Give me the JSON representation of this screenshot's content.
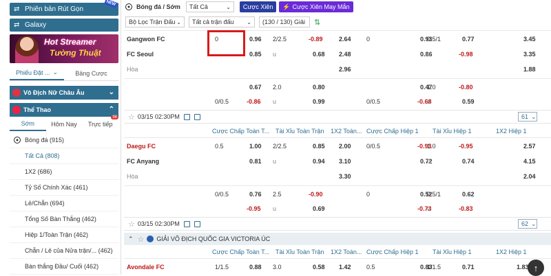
{
  "sidebar": {
    "rut_gon": "Phiên bản Rút Gọn",
    "new_badge": "NEW",
    "galaxy": "Galaxy",
    "banner_line1": "Hot Streamer",
    "banner_line2": "Tường Thuật",
    "tab_slip": "Phiếu Đặt ...",
    "tab_odds": "Bảng Cược",
    "womens_euro": "Vô Địch Nữ Châu Âu",
    "sports": "Thể Thao",
    "sport_tabs": [
      "Sớm",
      "Hôm Nay",
      "Trực tiếp"
    ],
    "live_count": "98",
    "menu_head": "Bóng đá (915)",
    "menu_items": [
      "Tất Cả (808)",
      "1X2 (686)",
      "Tỷ Số Chính Xác (461)",
      "Lẻ/Chẵn (694)",
      "Tổng Số Bàn Thắng (462)",
      "Hiệp 1/Toàn Trận (462)",
      "Chẵn / Lẻ của Nửa trận/... (462)",
      "Bàn thắng Đầu/ Cuối (462)"
    ]
  },
  "toolbar": {
    "title": "Bóng đá / Sớm",
    "filter_all": "Tất Cả",
    "parlay": "Cược Xiên",
    "lucky_parlay": "Cược Xiên May Mắn",
    "match_filter": "Bộ Lọc Trận Đấu",
    "all_matches": "Tất cả trận đấu",
    "league_count": "(130 / 130) Giải"
  },
  "match1": {
    "home": "Gangwon FC",
    "away": "FC Seoul",
    "draw": "Hòa",
    "r1": [
      "0",
      "0.96",
      "2/2.5",
      "-0.89",
      "2.64",
      "0",
      "0.93",
      "0.5/1",
      "0.77",
      "3.45"
    ],
    "r2": [
      "0.85",
      "u",
      "0.68",
      "2.48",
      "0.86",
      "u",
      "-0.98",
      "3.35"
    ],
    "r3": [
      "2.96",
      "1.88"
    ],
    "r4": [
      "0.67",
      "2.0",
      "0.80",
      "0.47",
      "1.0",
      "-0.80"
    ],
    "r5": [
      "0/0.5",
      "-0.86",
      "u",
      "0.99",
      "0/0.5",
      "-0.68",
      "u",
      "0.59"
    ]
  },
  "match2": {
    "time": "03/15 02:30PM",
    "more": "61",
    "headers": [
      "Cược Chấp Toàn T...",
      "Tài Xỉu Toàn Trận",
      "1X2 Toàn...",
      "Cược Chấp Hiệp 1",
      "Tài Xỉu Hiệp 1",
      "1X2 Hiệp 1"
    ],
    "home": "Daegu FC",
    "away": "FC Anyang",
    "draw": "Hòa",
    "r1": [
      "0.5",
      "1.00",
      "2/2.5",
      "0.85",
      "2.00",
      "0/0.5",
      "-0.93",
      "1.0",
      "-0.95",
      "2.57"
    ],
    "r2": [
      "0.81",
      "u",
      "0.94",
      "3.10",
      "0.72",
      "u",
      "0.74",
      "4.15"
    ],
    "r3": [
      "3.30",
      "2.04"
    ],
    "r4": [
      "0/0.5",
      "0.76",
      "2.5",
      "-0.90",
      "0",
      "0.52",
      "0.5/1",
      "0.62"
    ],
    "r5": [
      "-0.95",
      "u",
      "0.69",
      "-0.73",
      "u",
      "-0.83"
    ]
  },
  "match3": {
    "time": "03/15 02:30PM",
    "more": "62",
    "league": "GIẢI VÔ ĐỊCH QUỐC GIA VICTORIA ÚC",
    "headers": [
      "Cược Chấp Toàn T...",
      "Tài Xỉu Toàn Trận",
      "1X2 Toàn...",
      "Cược Chấp Hiệp 1",
      "Tài Xỉu Hiệp 1",
      "1X2 Hiệp 1"
    ],
    "home": "Avondale FC",
    "r1": [
      "1/1.5",
      "0.88",
      "3.0",
      "0.58",
      "1.42",
      "0.5",
      "0.83",
      "1/1.5",
      "0.71",
      "1.83"
    ]
  }
}
